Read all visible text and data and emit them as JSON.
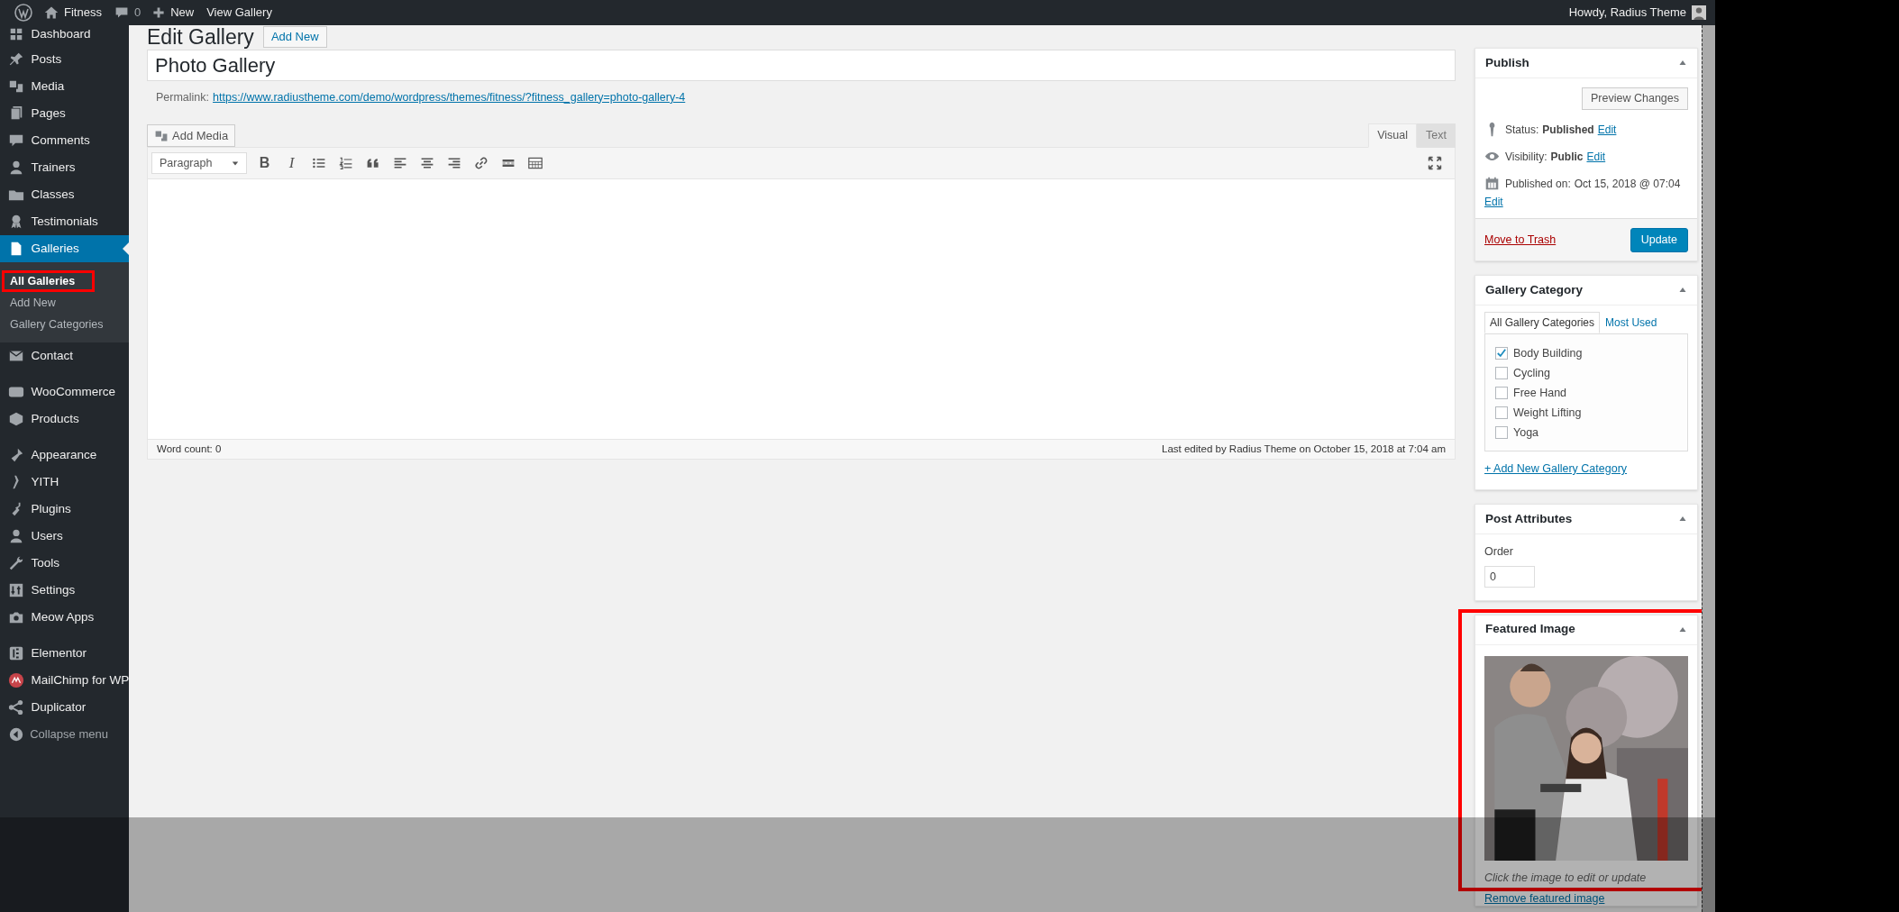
{
  "admin_bar": {
    "site": "Fitness",
    "comments": "0",
    "new": "New",
    "view": "View Gallery",
    "greeting": "Howdy, Radius Theme"
  },
  "sidebar": {
    "groups": [
      [
        {
          "label": "Dashboard",
          "selected": false
        }
      ],
      [
        {
          "label": "Posts",
          "selected": false
        },
        {
          "label": "Media",
          "selected": false
        },
        {
          "label": "Pages",
          "selected": false
        },
        {
          "label": "Comments",
          "selected": false
        },
        {
          "label": "Trainers",
          "selected": false
        },
        {
          "label": "Classes",
          "selected": false
        },
        {
          "label": "Testimonials",
          "selected": false
        },
        {
          "label": "Galleries",
          "selected": true,
          "children": [
            {
              "label": "All Galleries",
              "selected": true,
              "highlighted": true
            },
            {
              "label": "Add New",
              "selected": false,
              "highlighted": false
            },
            {
              "label": "Gallery Categories",
              "selected": false,
              "highlighted": false
            }
          ]
        },
        {
          "label": "Contact",
          "selected": false
        }
      ],
      [
        {
          "label": "WooCommerce",
          "selected": false
        },
        {
          "label": "Products",
          "selected": false
        }
      ],
      [
        {
          "label": "Appearance",
          "selected": false
        },
        {
          "label": "YITH",
          "selected": false
        },
        {
          "label": "Plugins",
          "selected": false
        },
        {
          "label": "Users",
          "selected": false
        },
        {
          "label": "Tools",
          "selected": false
        },
        {
          "label": "Settings",
          "selected": false
        },
        {
          "label": "Meow Apps",
          "selected": false
        }
      ],
      [
        {
          "label": "Elementor",
          "selected": false
        },
        {
          "label": "MailChimp for WP",
          "selected": false
        },
        {
          "label": "Duplicator",
          "selected": false
        }
      ]
    ],
    "collapse": "Collapse menu"
  },
  "page": {
    "heading": "Edit Gallery",
    "add_new": "Add New",
    "title": "Photo Gallery",
    "permalink_label": "Permalink:",
    "permalink_url": "https://www.radiustheme.com/demo/wordpress/themes/fitness/?fitness_gallery=photo-gallery-4",
    "add_media": "Add Media",
    "editor_tabs": [
      {
        "label": "Visual",
        "selected": true
      },
      {
        "label": "Text",
        "selected": false
      }
    ],
    "format": "Paragraph",
    "toolbar": [
      {
        "kind": "bold",
        "glyph": "B"
      },
      {
        "kind": "italic",
        "glyph": "I"
      },
      {
        "kind": "bullets"
      },
      {
        "kind": "numbers"
      },
      {
        "kind": "quote"
      },
      {
        "kind": "left"
      },
      {
        "kind": "center"
      },
      {
        "kind": "right"
      },
      {
        "kind": "link"
      },
      {
        "kind": "more"
      },
      {
        "kind": "kitchen"
      }
    ],
    "word_count": "Word count: 0",
    "last_edited": "Last edited by Radius Theme on October 15, 2018 at 7:04 am"
  },
  "publish": {
    "title": "Publish",
    "preview": "Preview Changes",
    "rows": [
      {
        "kind": "status",
        "label": "Status:",
        "value": "Published",
        "link": "Edit"
      },
      {
        "kind": "visibility",
        "label": "Visibility:",
        "value": "Public",
        "link": "Edit"
      },
      {
        "kind": "date",
        "label": "Published on:",
        "value": "Oct 15, 2018 @ 07:04",
        "link": "Edit"
      }
    ],
    "trash": "Move to Trash",
    "update": "Update"
  },
  "category": {
    "title": "Gallery Category",
    "tabs": [
      {
        "label": "All Gallery Categories",
        "selected": true
      },
      {
        "label": "Most Used",
        "selected": false
      }
    ],
    "items": [
      {
        "label": "Body Building",
        "checked": true
      },
      {
        "label": "Cycling",
        "checked": false
      },
      {
        "label": "Free Hand",
        "checked": false
      },
      {
        "label": "Weight Lifting",
        "checked": false
      },
      {
        "label": "Yoga",
        "checked": false
      }
    ],
    "add_link": "+ Add New Gallery Category"
  },
  "attributes": {
    "title": "Post Attributes",
    "order_label": "Order",
    "order_value": "0"
  },
  "featured": {
    "title": "Featured Image",
    "highlighted": true,
    "caption": "Click the image to edit or update",
    "remove_link": "Remove featured image"
  }
}
